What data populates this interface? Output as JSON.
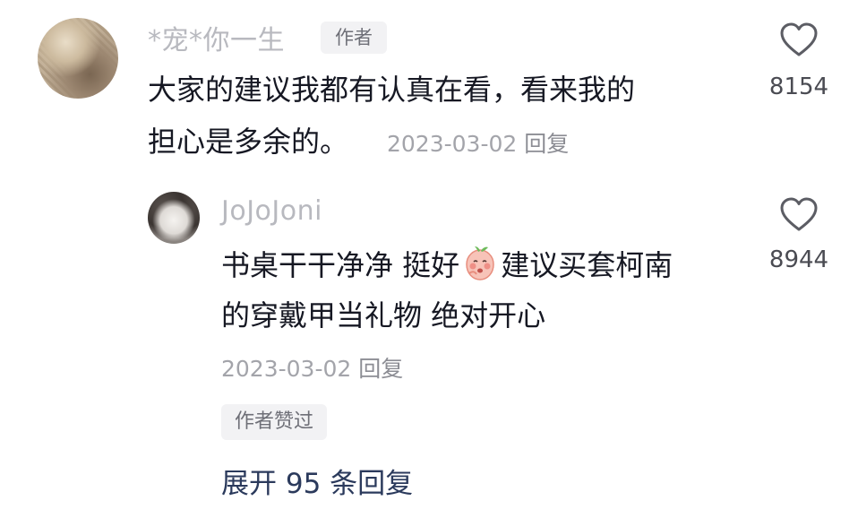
{
  "main_comment": {
    "username": "*宠*你一生",
    "author_tag": "作者",
    "text_line1": "大家的建议我都有认真在看，看来我的",
    "text_line2": "担心是多余的。",
    "date": "2023-03-02",
    "reply_label": "回复",
    "like_count": "8154",
    "avatar_icon": "avatar-photo"
  },
  "reply_comment": {
    "username": "JoJoJoni",
    "text_line1_before": "书桌干干净净 挺好",
    "emoji_icon": "peach-shy-emoji",
    "text_line1_after": "建议买套柯南",
    "text_line2": "的穿戴甲当礼物 绝对开心",
    "date": "2023-03-02",
    "reply_label": "回复",
    "liked_tag": "作者赞过",
    "like_count": "8944",
    "avatar_icon": "avatar-photo"
  },
  "expand_replies": "展开 95 条回复",
  "colors": {
    "text": "#161823",
    "muted": "#a3a4aa",
    "username": "#b8b9bf",
    "link": "#2b3a5c",
    "tag_bg": "#f2f2f4"
  }
}
